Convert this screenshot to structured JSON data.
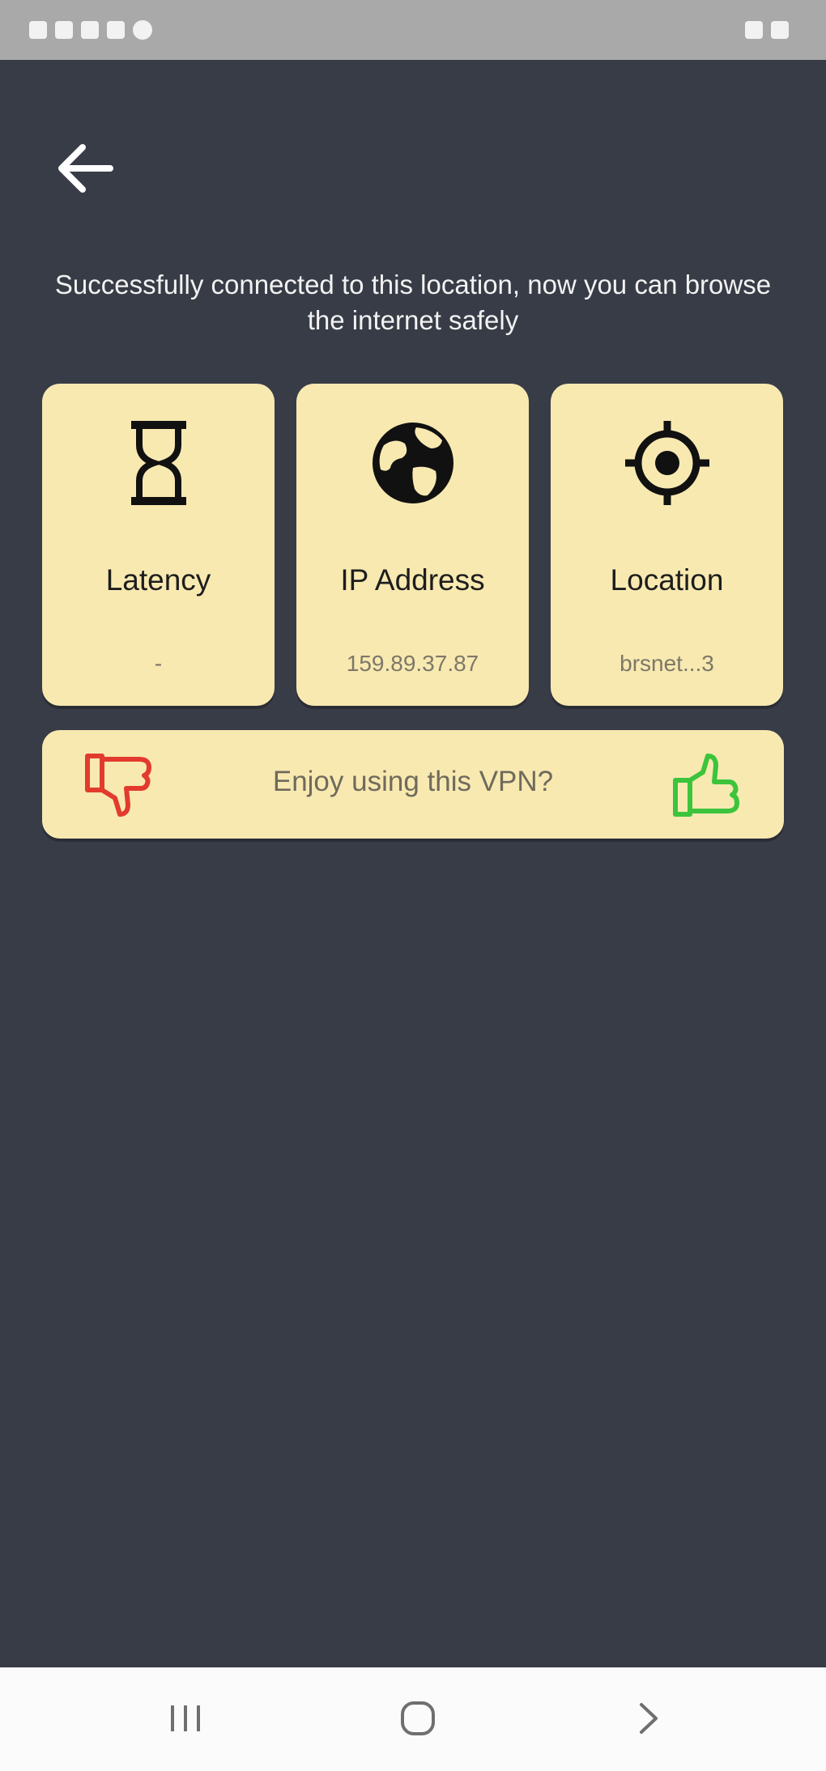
{
  "status_bar": {
    "left_text": "",
    "right_text": ""
  },
  "header": {
    "message": "Successfully connected to this location, now you can browse the internet safely"
  },
  "cards": [
    {
      "title": "Latency",
      "value": "-",
      "icon": "hourglass-icon"
    },
    {
      "title": "IP Address",
      "value": "159.89.37.87",
      "icon": "globe-icon"
    },
    {
      "title": "Location",
      "value": "brsnet...3",
      "icon": "location-target-icon"
    }
  ],
  "feedback": {
    "prompt": "Enjoy using this VPN?",
    "dislike_color": "#e23b2e",
    "like_color": "#3cc43c"
  },
  "colors": {
    "background": "#383c47",
    "card": "#f8e9b1",
    "status_bar": "#a9a9a9",
    "nav_bar": "#fbfbfb"
  },
  "nav": {
    "buttons": [
      "recent-apps",
      "home",
      "back"
    ]
  }
}
